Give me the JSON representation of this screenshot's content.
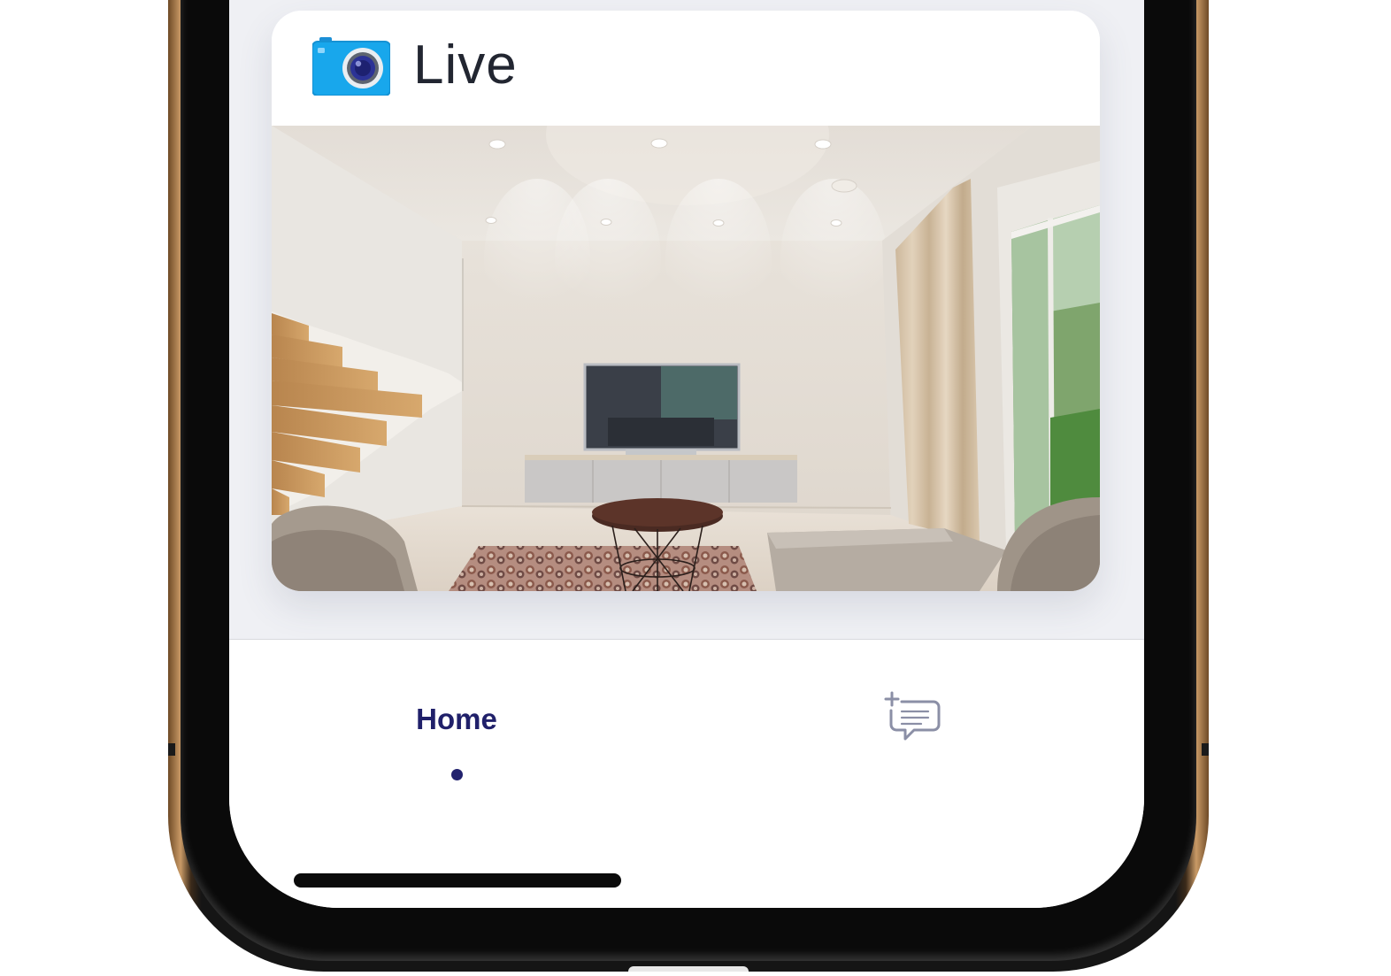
{
  "live_card": {
    "title": "Live",
    "icon": "camera-icon",
    "feed": "living-room-camera-feed"
  },
  "tab_bar": {
    "home_label": "Home",
    "home_active": true,
    "chat_icon": "add-comment-icon"
  },
  "colors": {
    "accent": "#20206a",
    "camera_blue": "#18a7ec",
    "background": "#eff0f4"
  }
}
